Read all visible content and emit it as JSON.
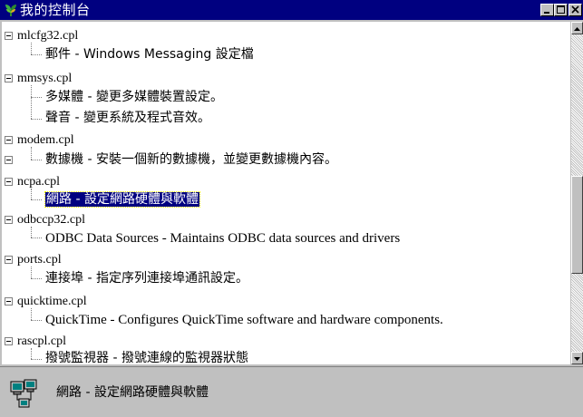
{
  "window": {
    "title": "我的控制台",
    "icon": "control-panel-icon",
    "buttons": [
      "minimize",
      "maximize",
      "close"
    ]
  },
  "tree": {
    "groups": [
      {
        "name": "mlcfg32.cpl",
        "expanded": true,
        "items": [
          {
            "label": "郵件 - Windows Messaging 設定檔"
          }
        ]
      },
      {
        "name": "mmsys.cpl",
        "expanded": true,
        "items": [
          {
            "label": "多媒體 - 變更多媒體裝置設定。"
          },
          {
            "label": "聲音 - 變更系統及程式音效。"
          }
        ]
      },
      {
        "name": "modem.cpl",
        "expanded": true,
        "items": [
          {
            "label": "數據機 - 安裝一個新的數據機，並變更數據機內容。"
          }
        ]
      },
      {
        "name": "ncpa.cpl",
        "expanded": true,
        "items": [
          {
            "label": "網路 - 設定網路硬體與軟體",
            "selected": true
          }
        ]
      },
      {
        "name": "odbccp32.cpl",
        "expanded": true,
        "items": [
          {
            "label": "ODBC Data Sources - Maintains ODBC data sources and drivers"
          }
        ]
      },
      {
        "name": "ports.cpl",
        "expanded": true,
        "items": [
          {
            "label": "連接埠 - 指定序列連接埠通訊設定。"
          }
        ]
      },
      {
        "name": "quicktime.cpl",
        "expanded": true,
        "items": [
          {
            "label": "QuickTime - Configures QuickTime software and hardware components."
          }
        ]
      },
      {
        "name": "rascpl.cpl",
        "expanded": true,
        "items": [
          {
            "label": "撥號監視器 - 撥號連線的監視器狀態"
          }
        ]
      }
    ]
  },
  "status": {
    "icon": "network-computers-icon",
    "text": "網路 - 設定網路硬體與軟體"
  },
  "colors": {
    "titlebar": "#000080",
    "selection": "#000080",
    "window_bg": "#c0c0c0"
  }
}
